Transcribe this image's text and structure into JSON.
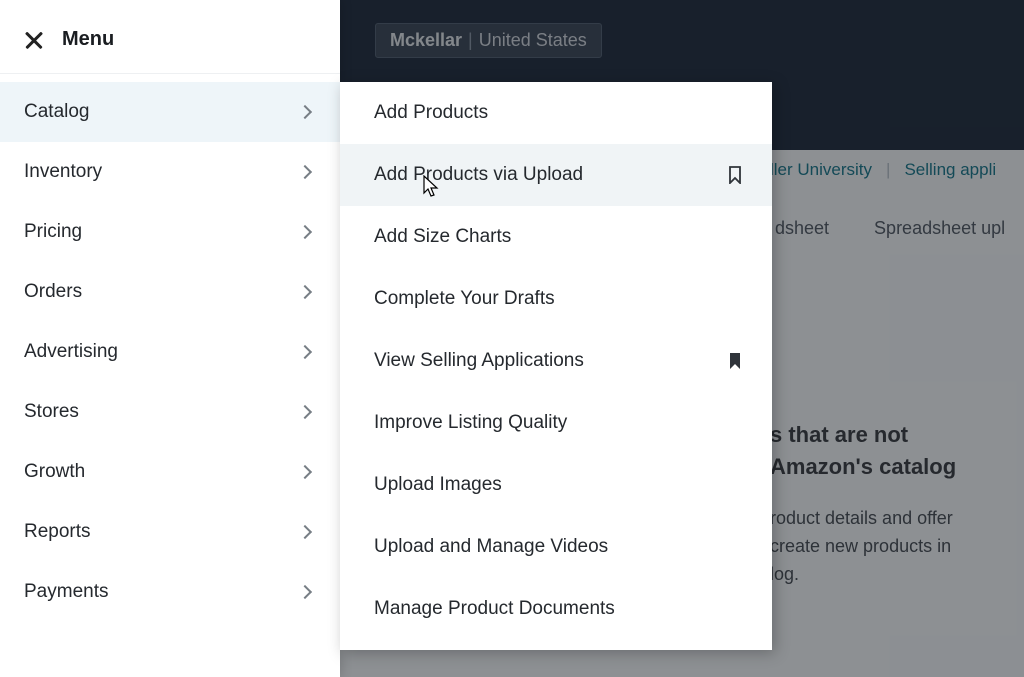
{
  "header": {
    "account_name": "Mckellar",
    "account_region": "United States"
  },
  "menu": {
    "title": "Menu",
    "items": [
      {
        "label": "Catalog",
        "active": true
      },
      {
        "label": "Inventory",
        "active": false
      },
      {
        "label": "Pricing",
        "active": false
      },
      {
        "label": "Orders",
        "active": false
      },
      {
        "label": "Advertising",
        "active": false
      },
      {
        "label": "Stores",
        "active": false
      },
      {
        "label": "Growth",
        "active": false
      },
      {
        "label": "Reports",
        "active": false
      },
      {
        "label": "Payments",
        "active": false
      }
    ]
  },
  "submenu": {
    "items": [
      {
        "label": "Add Products",
        "bookmark": "none",
        "hover": false
      },
      {
        "label": "Add Products via Upload",
        "bookmark": "outline",
        "hover": true
      },
      {
        "label": "Add Size Charts",
        "bookmark": "none",
        "hover": false
      },
      {
        "label": "Complete Your Drafts",
        "bookmark": "none",
        "hover": false
      },
      {
        "label": "View Selling Applications",
        "bookmark": "filled",
        "hover": false
      },
      {
        "label": "Improve Listing Quality",
        "bookmark": "none",
        "hover": false
      },
      {
        "label": "Upload Images",
        "bookmark": "none",
        "hover": false
      },
      {
        "label": "Upload and Manage Videos",
        "bookmark": "none",
        "hover": false
      },
      {
        "label": "Manage Product Documents",
        "bookmark": "none",
        "hover": false
      }
    ]
  },
  "background": {
    "links": [
      "ller University",
      "Selling appli"
    ],
    "tabs": [
      "dsheet",
      "Spreadsheet upl"
    ],
    "heading_line1": "s that are not",
    "heading_line2": "Amazon's catalog",
    "body_line1": "roduct details and offer",
    "body_line2": "create new products in",
    "body_line3": "log."
  }
}
